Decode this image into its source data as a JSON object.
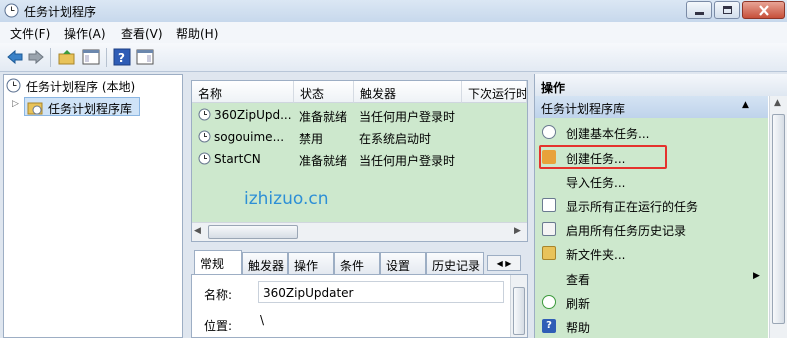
{
  "window": {
    "title": "任务计划程序"
  },
  "menu": [
    "文件(F)",
    "操作(A)",
    "查看(V)",
    "帮助(H)"
  ],
  "tree": {
    "root": "任务计划程序 (本地)",
    "child": "任务计划程序库"
  },
  "task_list": {
    "columns": [
      "名称",
      "状态",
      "触发器",
      "下次运行时"
    ],
    "rows": [
      {
        "name": "360ZipUpd...",
        "status": "准备就绪",
        "trigger": "当任何用户登录时"
      },
      {
        "name": "sogouime...",
        "status": "禁用",
        "trigger": "在系统启动时"
      },
      {
        "name": "StartCN",
        "status": "准备就绪",
        "trigger": "当任何用户登录时"
      }
    ],
    "watermark": "izhizuo.cn"
  },
  "details": {
    "tabs": [
      "常规",
      "触发器",
      "操作",
      "条件",
      "设置",
      "历史记录"
    ],
    "name_label": "名称:",
    "name_value": "360ZipUpdater",
    "location_label": "位置:",
    "location_value": "\\"
  },
  "actions": {
    "header": "操作",
    "section": "任务计划程序库",
    "items": [
      "创建基本任务...",
      "创建任务...",
      "导入任务...",
      "显示所有正在运行的任务",
      "启用所有任务历史记录",
      "新文件夹...",
      "查看",
      "刷新",
      "帮助"
    ]
  },
  "colors": {
    "accent_green": "#cde8cd",
    "highlight_red": "#e5322d",
    "watermark": "#2d8fd6"
  }
}
